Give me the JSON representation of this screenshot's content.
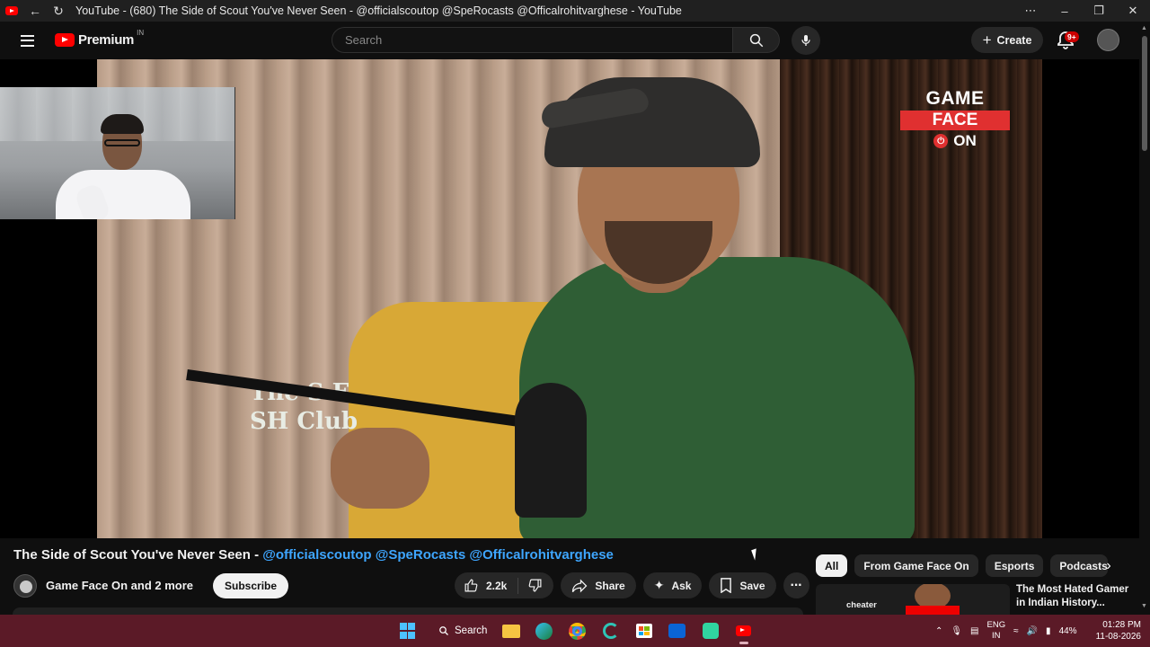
{
  "window": {
    "title": "YouTube - (680) The Side of Scout You've Never Seen - @officialscoutop @SpeRocasts @Officalrohitvarghese - YouTube"
  },
  "header": {
    "brand": "Premium",
    "region": "IN",
    "search_placeholder": "Search",
    "create_label": "Create",
    "notification_count": "9+"
  },
  "video_overlay": {
    "brand_line1": "GAME",
    "brand_line2": "FACE",
    "brand_line3": "ON",
    "shirt_text": "The S  E  SH Club"
  },
  "video": {
    "title_plain": "The Side of Scout You've Never Seen - ",
    "title_tags": "@officialscoutop @SpeRocasts @Officalrohitvarghese",
    "channel": "Game Face On and 2 more",
    "subscribe_label": "Subscribe",
    "likes": "2.2k",
    "share_label": "Share",
    "ask_label": "Ask",
    "save_label": "Save"
  },
  "filters": {
    "chips": [
      "All",
      "From Game Face On",
      "Esports",
      "Podcasts"
    ],
    "active": "All"
  },
  "recommendation": {
    "title": "The Most Hated Gamer in Indian History...",
    "thumb_text": "cheater"
  },
  "taskbar": {
    "search_label": "Search",
    "lang_line1": "ENG",
    "lang_line2": "IN",
    "battery": "44%",
    "time": "01:28 PM",
    "date": "11-08-2026"
  },
  "colors": {
    "accent_red": "#ff0000",
    "link_blue": "#3ea6ff",
    "taskbar": "#5b1a27",
    "brand_red": "#e03030"
  }
}
